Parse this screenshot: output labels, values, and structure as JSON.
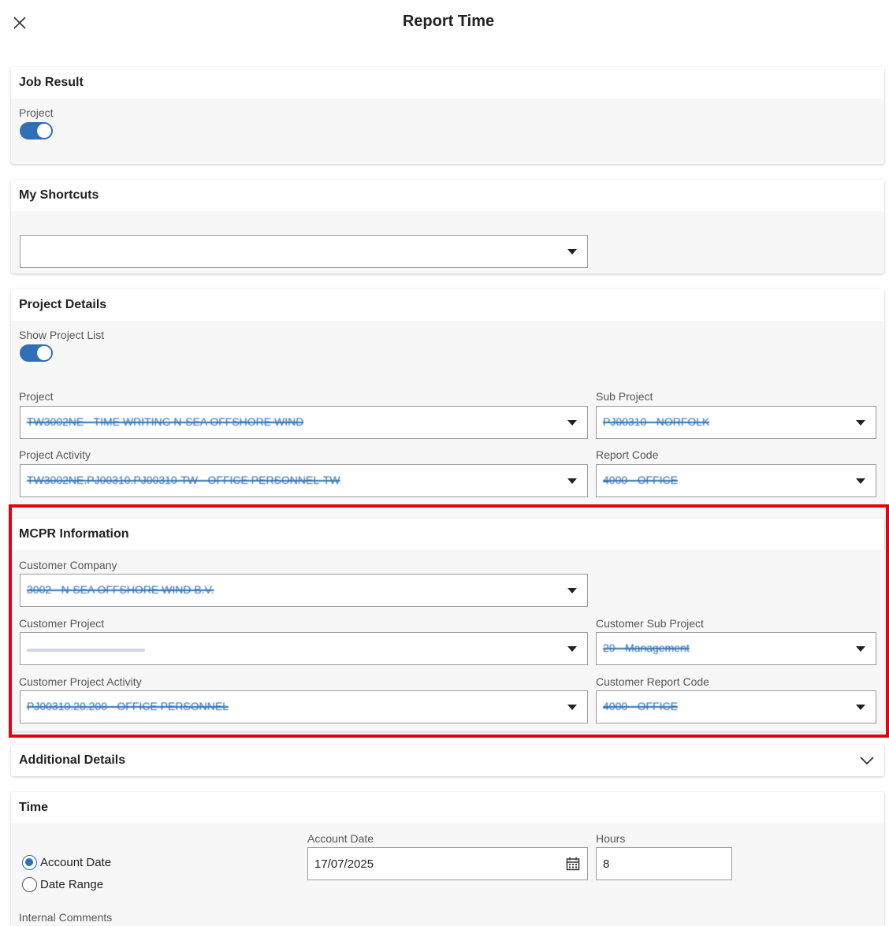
{
  "header": {
    "title": "Report Time"
  },
  "job_result": {
    "title": "Job Result",
    "project_label": "Project",
    "project_toggle": true
  },
  "shortcuts": {
    "title": "My Shortcuts",
    "value": ""
  },
  "project_details": {
    "title": "Project Details",
    "show_list_label": "Show Project List",
    "show_list_toggle": true,
    "project_label": "Project",
    "project_value": "TW3002NE - TIME WRITING N-SEA OFFSHORE WIND",
    "sub_project_label": "Sub Project",
    "sub_project_value": "PJ00310 - NORFOLK",
    "activity_label": "Project Activity",
    "activity_value": "TW3002NE.PJ00310.PJ00310-TW - OFFICE PERSONNEL-TW",
    "report_code_label": "Report Code",
    "report_code_value": "4000 - OFFICE"
  },
  "mcpr": {
    "title": "MCPR Information",
    "company_label": "Customer Company",
    "company_value": "3002 - N-SEA OFFSHORE WIND B.V.",
    "project_label": "Customer Project",
    "project_value": "",
    "sub_project_label": "Customer Sub Project",
    "sub_project_value": "20 - Management",
    "activity_label": "Customer Project Activity",
    "activity_value": "PJ00310.20.200 - OFFICE PERSONNEL",
    "report_code_label": "Customer Report Code",
    "report_code_value": "4000 - OFFICE"
  },
  "additional": {
    "title": "Additional Details"
  },
  "time": {
    "title": "Time",
    "radio_account_date": "Account Date",
    "radio_date_range": "Date Range",
    "selected": "Account Date",
    "account_date_label": "Account Date",
    "account_date_value": "17/07/2025",
    "hours_label": "Hours",
    "hours_value": "8",
    "internal_comments_label": "Internal Comments"
  },
  "colors": {
    "accent": "#2f6fb5",
    "highlight": "#e8000b"
  }
}
